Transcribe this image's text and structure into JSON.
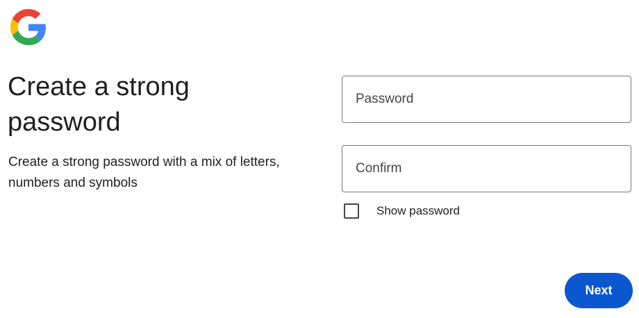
{
  "brand": {
    "logo_icon": "google-g-logo-icon",
    "colors": {
      "blue": "#4285F4",
      "red": "#EA4335",
      "yellow": "#FBBC05",
      "green": "#34A853"
    }
  },
  "main": {
    "heading": "Create a strong password",
    "subtext": "Create a strong password with a mix of letters, numbers and symbols"
  },
  "form": {
    "password": {
      "placeholder": "Password",
      "value": ""
    },
    "confirm": {
      "placeholder": "Confirm",
      "value": ""
    },
    "show_password": {
      "label": "Show password",
      "checked": false
    }
  },
  "actions": {
    "next_label": "Next",
    "accent": "#0b57d0"
  }
}
